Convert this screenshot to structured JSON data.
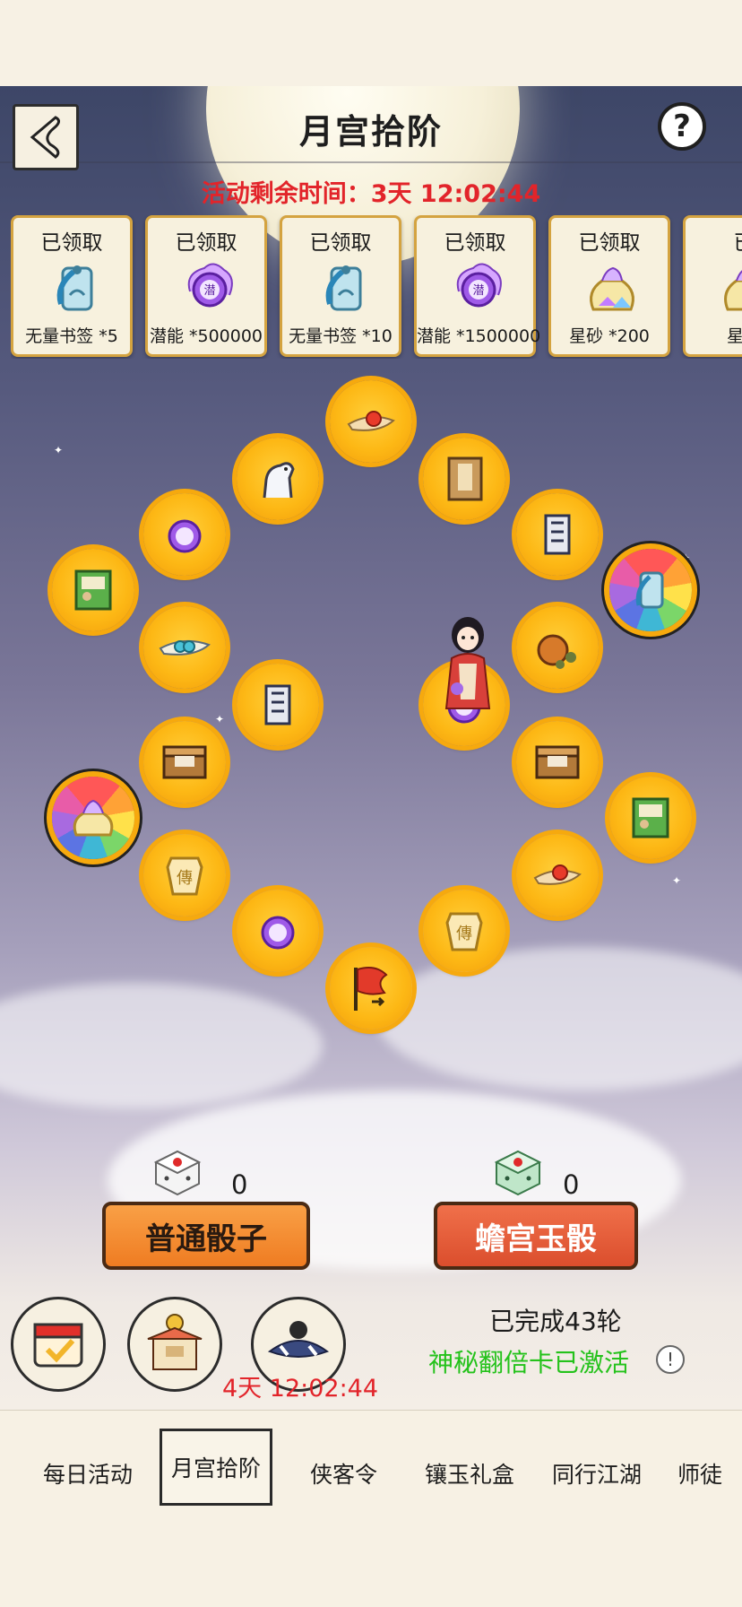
{
  "header": {
    "title": "月宫拾阶",
    "timer_text": "活动剩余时间：3天 12:02:44"
  },
  "rewards": [
    {
      "status": "已领取",
      "name": "无量书签 *5",
      "icon": "bookmark-icon"
    },
    {
      "status": "已领取",
      "name": "潜能 *500000",
      "icon": "potential-orb-icon"
    },
    {
      "status": "已领取",
      "name": "无量书签 *10",
      "icon": "bookmark-icon"
    },
    {
      "status": "已领取",
      "name": "潜能 *1500000",
      "icon": "potential-orb-icon"
    },
    {
      "status": "已领取",
      "name": "星砂 *200",
      "icon": "star-sand-pouch-icon"
    },
    {
      "status": "已",
      "name": "星砂",
      "icon": "star-sand-pouch-icon"
    }
  ],
  "board": {
    "cells": [
      {
        "icon": "flag-start-icon"
      },
      {
        "icon": "manual-icon"
      },
      {
        "icon": "scroll-icon"
      },
      {
        "icon": "chest-icon"
      },
      {
        "icon": "wine-gourd-icon"
      },
      {
        "icon": "scroll-icon"
      },
      {
        "icon": "book-icon"
      },
      {
        "icon": "red-pill-icon"
      },
      {
        "icon": "white-horse-icon"
      },
      {
        "icon": "potential-orb-icon"
      },
      {
        "icon": "teal-pill-icon"
      },
      {
        "icon": "chest-icon"
      },
      {
        "icon": "manual-icon"
      },
      {
        "icon": "potential-orb-icon"
      },
      {
        "icon": "red-pill-icon"
      },
      {
        "icon": "scroll-icon"
      },
      {
        "icon": "potential-orb-icon"
      },
      {
        "icon": "book-icon"
      },
      {
        "icon": "bookmark-wheel-icon"
      },
      {
        "icon": "star-sand-wheel-icon"
      }
    ],
    "character": "player-character"
  },
  "dice": {
    "normal": {
      "label": "普通骰子",
      "count": "0"
    },
    "jade": {
      "label": "蟾宫玉骰",
      "count": "0"
    }
  },
  "status": {
    "rounds": "已完成43轮",
    "buff": "神秘翻倍卡已激活",
    "shop_timer": "4天 12:02:44"
  },
  "tabs": [
    {
      "label": "每日活动"
    },
    {
      "label": "月宫拾阶"
    },
    {
      "label": "侠客令"
    },
    {
      "label": "镶玉礼盒"
    },
    {
      "label": "同行江湖"
    },
    {
      "label": "师徒"
    }
  ]
}
